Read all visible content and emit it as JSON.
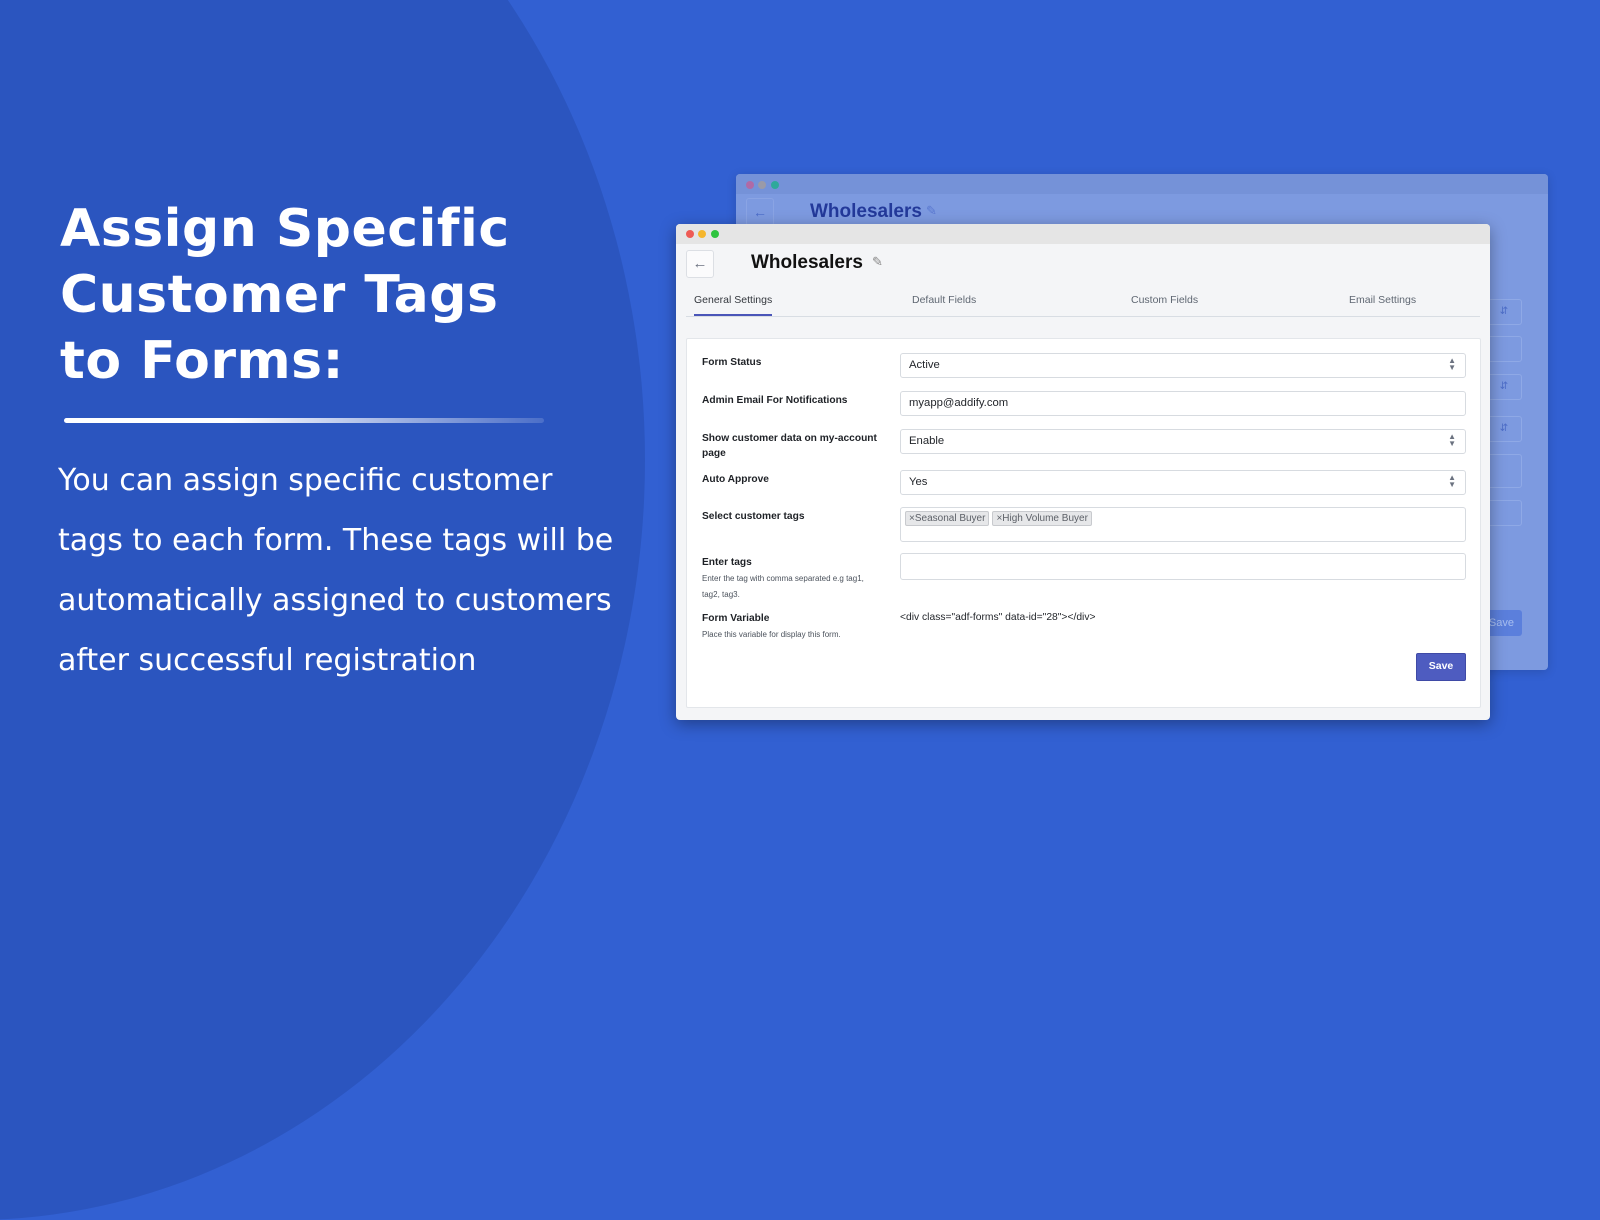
{
  "hero": {
    "title_lines": [
      "Assign Specific",
      "Customer Tags",
      "to Forms:"
    ],
    "body": "You can assign specific customer tags to each form. These tags will be automatically assigned to customers after successful registration"
  },
  "back_window": {
    "title": "Wholesalers",
    "back_icon": "arrow-left-icon",
    "save_label": "Save"
  },
  "window": {
    "title": "Wholesalers",
    "back_icon": "arrow-left-icon",
    "edit_icon": "pencil-icon",
    "tabs": [
      {
        "label": "General Settings",
        "active": true
      },
      {
        "label": "Default Fields",
        "active": false
      },
      {
        "label": "Custom Fields",
        "active": false
      },
      {
        "label": "Email Settings",
        "active": false
      }
    ],
    "form": {
      "form_status": {
        "label": "Form Status",
        "value": "Active"
      },
      "admin_email": {
        "label": "Admin Email For Notifications",
        "value": "myapp@addify.com"
      },
      "show_customer_data": {
        "label": "Show customer data on my-account page",
        "value": "Enable"
      },
      "auto_approve": {
        "label": "Auto Approve",
        "value": "Yes"
      },
      "customer_tags": {
        "label": "Select customer tags",
        "tags": [
          "Seasonal Buyer",
          "High Volume Buyer"
        ],
        "remove_glyph": "×"
      },
      "enter_tags": {
        "label": "Enter tags",
        "help": "Enter the tag with comma separated e.g tag1, tag2, tag3.",
        "value": ""
      },
      "form_variable": {
        "label": "Form Variable",
        "help": "Place this variable for display this form.",
        "value": "<div class=\"adf-forms\" data-id=\"28\"></div>"
      }
    },
    "save_label": "Save"
  },
  "colors": {
    "background": "#3260d2",
    "circle": "#2b55bf",
    "accent": "#4e5cc0"
  }
}
